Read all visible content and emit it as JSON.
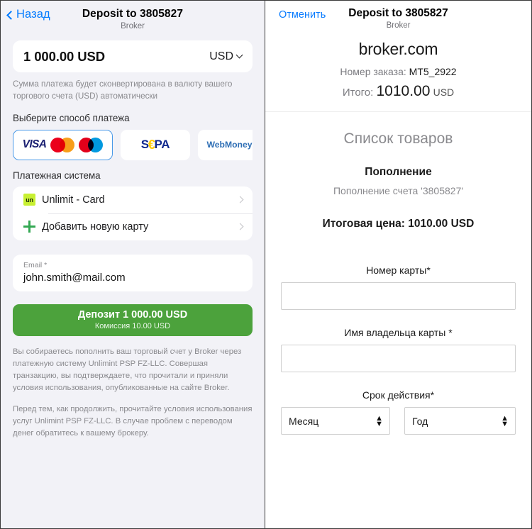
{
  "left": {
    "back_label": "Назад",
    "title": "Deposit to 3805827",
    "subtitle": "Broker",
    "amount_value": "1 000.00 USD",
    "currency_code": "USD",
    "conversion_note": "Сумма платежа будет сконвертирована в валюту вашего торгового счета (USD) автоматически",
    "methods_label": "Выберите способ платежа",
    "methods": [
      {
        "id": "cards",
        "visa": "VISA",
        "selected": true
      },
      {
        "id": "sepa",
        "text_s": "S",
        "text_e": "€",
        "text_pa": "PA"
      },
      {
        "id": "webmoney",
        "label": "WebMoney"
      }
    ],
    "payment_system_label": "Платежная система",
    "rows": [
      {
        "badge": "un",
        "label": "Unlimit - Card"
      },
      {
        "badge": "+",
        "label": "Добавить новую карту"
      }
    ],
    "email_label": "Email *",
    "email_value": "john.smith@mail.com",
    "deposit_main": "Депозит 1 000.00 USD",
    "deposit_sub": "Комиссия 10.00 USD",
    "legal_1": "Вы собираетесь пополнить ваш торговый счет у Broker через платежную систему Unlimint PSP FZ-LLC. Совершая транзакцию, вы подтверждаете, что прочитали и приняли условия использования, опубликованные на сайте Broker.",
    "legal_2": "Перед тем, как продолжить, прочитайте условия использования услуг Unlimint PSP FZ-LLC. В случае проблем с переводом денег обратитесь к вашему брокеру."
  },
  "right": {
    "cancel_label": "Отменить",
    "title": "Deposit to 3805827",
    "subtitle": "Broker",
    "merchant": "broker.com",
    "order_label": "Номер заказа:",
    "order_number": "MT5_2922",
    "total_label": "Итого:",
    "total_amount": "1010.00",
    "total_currency": "USD",
    "goods_title": "Список товаров",
    "goods_item": "Пополнение",
    "goods_desc": "Пополнение счета '3805827'",
    "goods_total": "Итоговая цена: 1010.00 USD",
    "form": {
      "card_number_label": "Номер карты*",
      "card_number_value": "",
      "card_holder_label": "Имя владельца карты *",
      "card_holder_value": "",
      "expiry_label": "Срок действия*",
      "month_selected": "Месяц",
      "year_selected": "Год"
    }
  },
  "colors": {
    "ios_blue": "#007aff",
    "link_blue": "#0a7cff",
    "deposit_green": "#4ca23c",
    "unlimit_lime": "#c8f032",
    "panel_bg": "#f2f2f7"
  }
}
